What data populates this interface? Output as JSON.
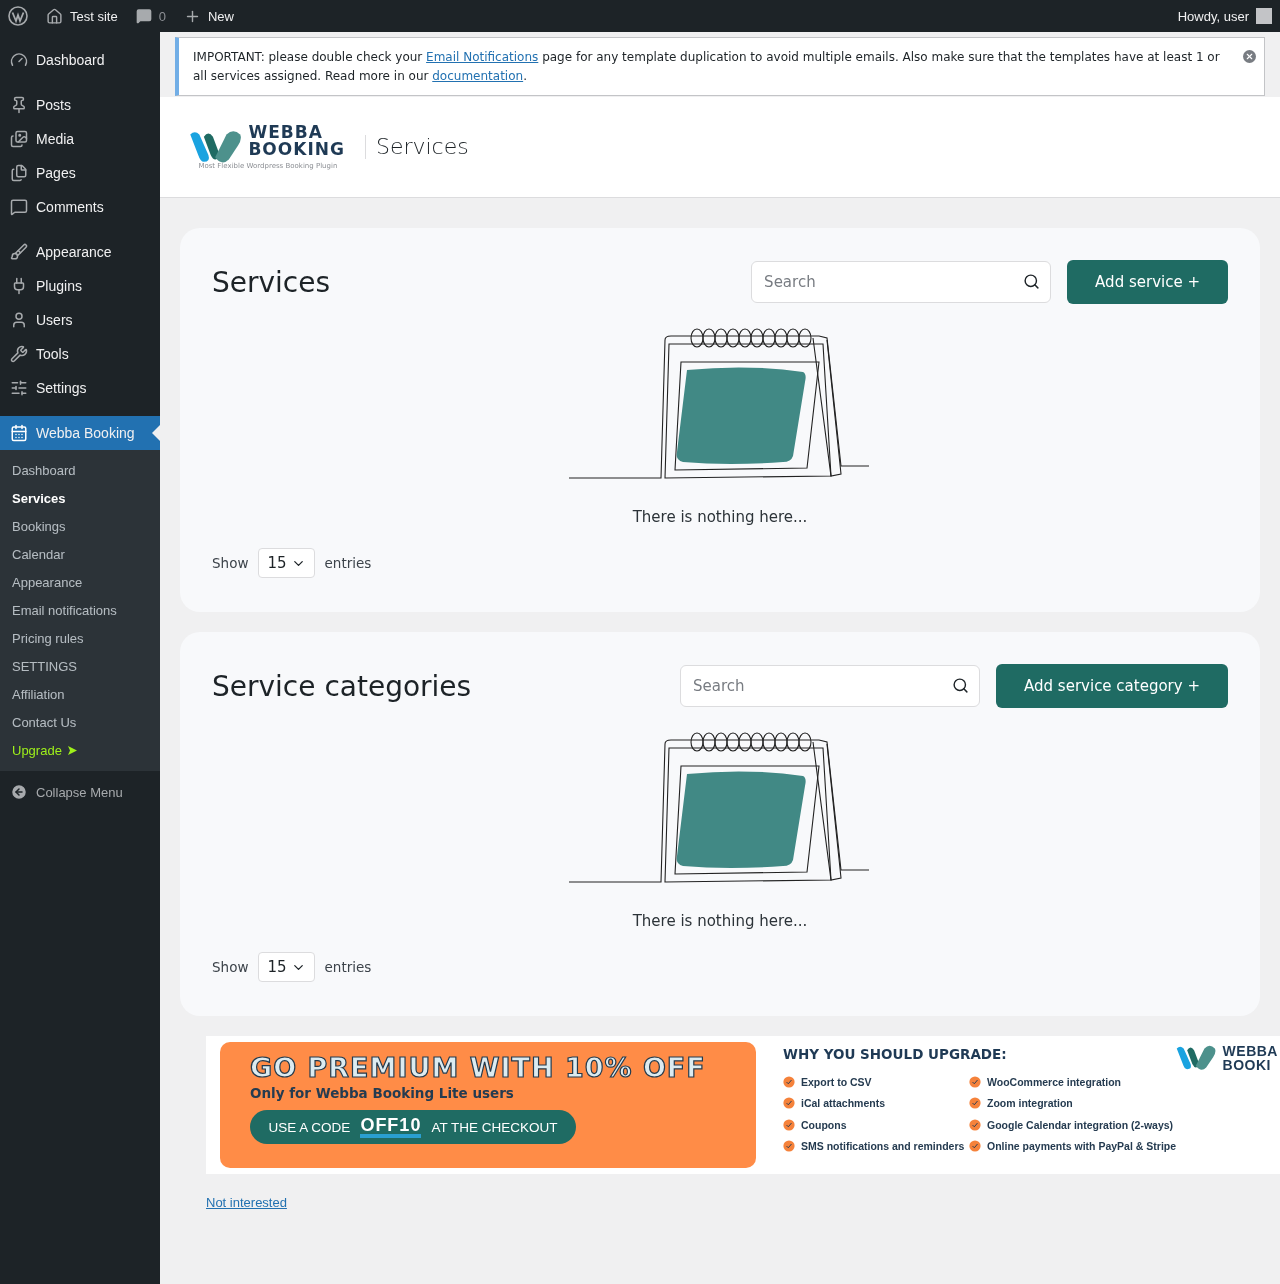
{
  "admin_bar": {
    "site": "Test site",
    "comments": "0",
    "new": "New",
    "greeting": "Howdy, user"
  },
  "sidebar": {
    "groups": [
      [
        {
          "label": "Dashboard",
          "selected": false
        }
      ],
      [
        {
          "label": "Posts",
          "selected": false
        },
        {
          "label": "Media",
          "selected": false
        },
        {
          "label": "Pages",
          "selected": false
        },
        {
          "label": "Comments",
          "selected": false
        }
      ],
      [
        {
          "label": "Appearance",
          "selected": false
        },
        {
          "label": "Plugins",
          "selected": false
        },
        {
          "label": "Users",
          "selected": false
        },
        {
          "label": "Tools",
          "selected": false
        },
        {
          "label": "Settings",
          "selected": false
        }
      ],
      [
        {
          "label": "Webba Booking",
          "selected": true
        }
      ]
    ],
    "submenu": [
      {
        "label": "Dashboard",
        "selected": false,
        "kind": "link"
      },
      {
        "label": "Services",
        "selected": true,
        "kind": "link"
      },
      {
        "label": "Bookings",
        "selected": false,
        "kind": "link"
      },
      {
        "label": "Calendar",
        "selected": false,
        "kind": "link"
      },
      {
        "label": "Appearance",
        "selected": false,
        "kind": "link"
      },
      {
        "label": "Email notifications",
        "selected": false,
        "kind": "link"
      },
      {
        "label": "Pricing rules",
        "selected": false,
        "kind": "link"
      },
      {
        "label": "SETTINGS",
        "selected": false,
        "kind": "link"
      },
      {
        "label": "Affiliation",
        "selected": false,
        "kind": "link"
      },
      {
        "label": "Contact Us",
        "selected": false,
        "kind": "link"
      },
      {
        "label": "Upgrade",
        "selected": false,
        "kind": "upgrade"
      }
    ],
    "collapse": "Collapse Menu"
  },
  "notice": {
    "parts": [
      {
        "kind": "text",
        "text": "IMPORTANT: please double check your "
      },
      {
        "kind": "link",
        "text": "Email Notifications"
      },
      {
        "kind": "text",
        "text": " page for any template duplication to avoid multiple emails. Also make sure that the templates have at least 1 or all services assigned. Read more in our "
      },
      {
        "kind": "link",
        "text": "documentation"
      },
      {
        "kind": "text",
        "text": "."
      }
    ]
  },
  "header": {
    "logo_top": "WEBBA",
    "logo_bottom": "BOOKING",
    "logo_tagline": "Most Flexible Wordpress Booking Plugin",
    "title": "Services"
  },
  "panels": [
    {
      "title": "Services",
      "search_placeholder": "Search",
      "button": "Add service +",
      "empty_text": "There is nothing here...",
      "show": "Show",
      "page_size": "15",
      "entries": "entries"
    },
    {
      "title": "Service categories",
      "search_placeholder": "Search",
      "button": "Add service category +",
      "empty_text": "There is nothing here...",
      "show": "Show",
      "page_size": "15",
      "entries": "entries"
    }
  ],
  "promo": {
    "headline": "GO PREMIUM WITH 10% OFF",
    "subline": "Only for Webba Booking Lite users",
    "code_before": "USE A CODE",
    "code": "OFF10",
    "code_after": "AT THE CHECKOUT",
    "why_title": "WHY YOU SHOULD UPGRADE:",
    "features": [
      "Export to CSV",
      "iCal attachments",
      "Coupons",
      "SMS notifications and reminders",
      "WooCommerce integration",
      "Zoom integration",
      "Google Calendar integration (2-ways)",
      "Online payments with PayPal & Stripe"
    ],
    "logo_top": "WEBBA",
    "logo_bottom": "BOOKI"
  },
  "not_interested": "Not interested"
}
